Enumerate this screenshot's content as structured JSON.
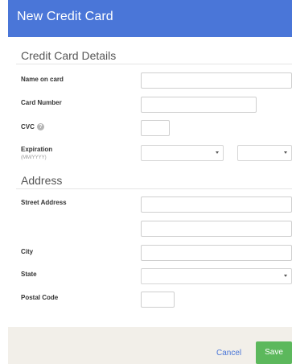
{
  "dialog": {
    "title": "New Credit Card"
  },
  "card_section": {
    "title": "Credit Card Details",
    "name_label": "Name on card",
    "number_label": "Card Number",
    "cvc_label": "CVC",
    "help_glyph": "?",
    "expiration_label": "Expiration",
    "expiration_hint": "(MM/YYYY)",
    "name_value": "",
    "number_value": "",
    "cvc_value": "",
    "month_value": "",
    "year_value": ""
  },
  "address_section": {
    "title": "Address",
    "street_label": "Street Address",
    "city_label": "City",
    "state_label": "State",
    "postal_label": "Postal Code",
    "street1_value": "",
    "street2_value": "",
    "city_value": "",
    "state_value": "",
    "postal_value": ""
  },
  "footer": {
    "cancel_label": "Cancel",
    "save_label": "Save"
  },
  "colors": {
    "header": "#4a76d8",
    "save": "#5cb85c",
    "footer": "#f2efe9",
    "link": "#4a76d8"
  },
  "icons": {
    "help": "help-circle-icon",
    "dropdown": "chevron-down-icon"
  }
}
